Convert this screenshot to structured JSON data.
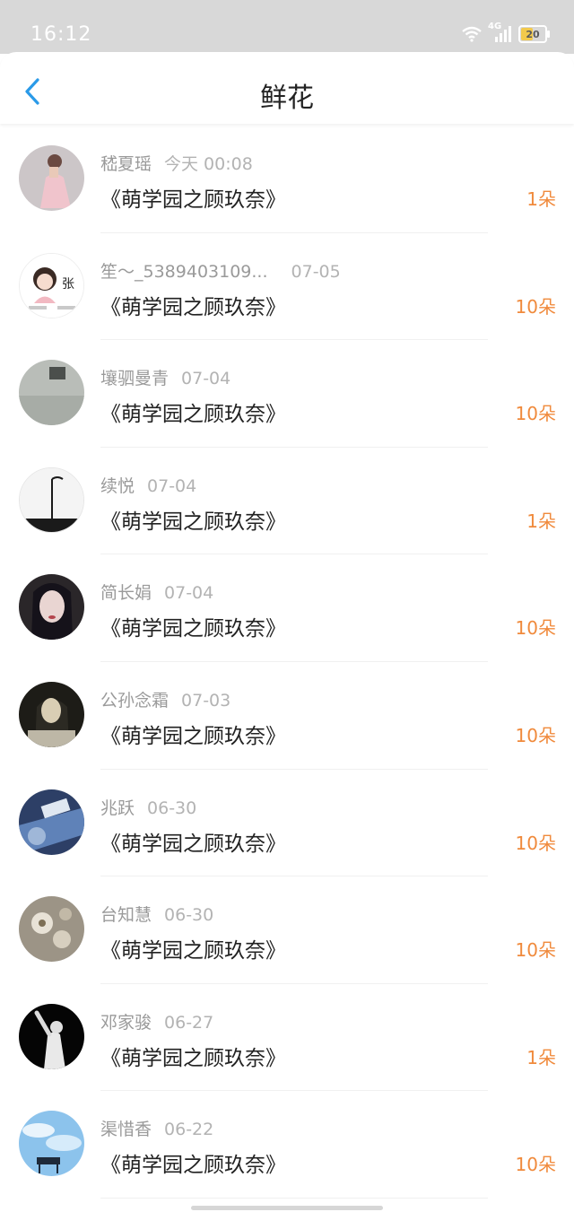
{
  "status_bar": {
    "time": "16:12",
    "network": "4G",
    "battery": "20"
  },
  "nav": {
    "title": "鲜花",
    "back_icon": "chevron-left-icon"
  },
  "colors": {
    "accent": "#2a9ae8",
    "count": "#f08a3c",
    "status_bg": "#d8d8d8"
  },
  "rows": [
    {
      "name": "嵇夏瑶",
      "date": "今天 00:08",
      "book": "《萌学园之顾玖奈》",
      "count": "1朵"
    },
    {
      "name": "笙～_5389403109...",
      "date": "07-05",
      "book": "《萌学园之顾玖奈》",
      "count": "10朵"
    },
    {
      "name": "壤驷曼青",
      "date": "07-04",
      "book": "《萌学园之顾玖奈》",
      "count": "10朵"
    },
    {
      "name": "续悦",
      "date": "07-04",
      "book": "《萌学园之顾玖奈》",
      "count": "1朵"
    },
    {
      "name": "简长娟",
      "date": "07-04",
      "book": "《萌学园之顾玖奈》",
      "count": "10朵"
    },
    {
      "name": "公孙念霜",
      "date": "07-03",
      "book": "《萌学园之顾玖奈》",
      "count": "10朵"
    },
    {
      "name": "兆跃",
      "date": "06-30",
      "book": "《萌学园之顾玖奈》",
      "count": "10朵"
    },
    {
      "name": "台知慧",
      "date": "06-30",
      "book": "《萌学园之顾玖奈》",
      "count": "10朵"
    },
    {
      "name": "邓家骏",
      "date": "06-27",
      "book": "《萌学园之顾玖奈》",
      "count": "1朵"
    },
    {
      "name": "渠惜香",
      "date": "06-22",
      "book": "《萌学园之顾玖奈》",
      "count": "10朵"
    }
  ],
  "avatar_badge_text": "张"
}
